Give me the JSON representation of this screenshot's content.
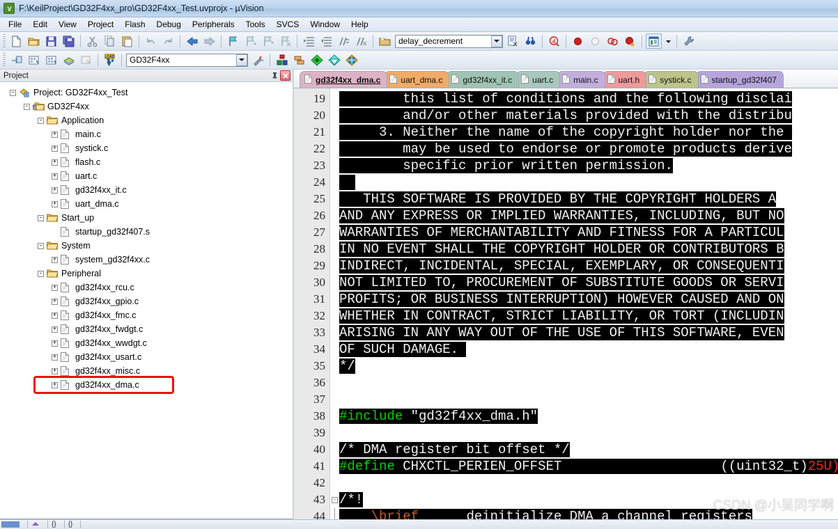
{
  "window": {
    "title": "F:\\KeilProject\\GD32F4xx_pro\\GD32F4xx_Test.uvprojx - µVision",
    "app_icon_text": "µV"
  },
  "menu": {
    "items": [
      {
        "label": "File"
      },
      {
        "label": "Edit"
      },
      {
        "label": "View"
      },
      {
        "label": "Project"
      },
      {
        "label": "Flash"
      },
      {
        "label": "Debug"
      },
      {
        "label": "Peripherals"
      },
      {
        "label": "Tools"
      },
      {
        "label": "SVCS"
      },
      {
        "label": "Window"
      },
      {
        "label": "Help"
      }
    ]
  },
  "toolbar1": {
    "buttons": [
      {
        "name": "new-file-button",
        "icon": "new-file-icon"
      },
      {
        "name": "open-file-button",
        "icon": "open-folder-icon"
      },
      {
        "name": "save-button",
        "icon": "save-disk-icon"
      },
      {
        "name": "save-all-button",
        "icon": "save-all-icon"
      },
      {
        "name": "cut-button",
        "icon": "scissors-icon"
      },
      {
        "name": "copy-button",
        "icon": "copy-icon"
      },
      {
        "name": "paste-button",
        "icon": "paste-icon"
      },
      {
        "name": "undo-button",
        "icon": "undo-arrow-icon"
      },
      {
        "name": "redo-button",
        "icon": "redo-arrow-icon"
      },
      {
        "name": "navigate-back-button",
        "icon": "arrow-left-icon"
      },
      {
        "name": "navigate-forward-button",
        "icon": "arrow-right-icon"
      },
      {
        "name": "bookmark-toggle-button",
        "icon": "bookmark-flag-icon"
      },
      {
        "name": "bookmark-prev-button",
        "icon": "bookmark-up-icon"
      },
      {
        "name": "bookmark-next-button",
        "icon": "bookmark-down-icon"
      },
      {
        "name": "bookmark-clear-button",
        "icon": "bookmark-clear-icon"
      },
      {
        "name": "indent-increase-button",
        "icon": "indent-right-icon"
      },
      {
        "name": "indent-decrease-button",
        "icon": "indent-left-icon"
      },
      {
        "name": "comment-lines-button",
        "icon": "comment-icon"
      },
      {
        "name": "uncomment-lines-button",
        "icon": "uncomment-icon"
      }
    ],
    "function_combo": {
      "name": "function-navigate-combo",
      "value": "delay_decrement"
    },
    "after_combo_buttons": [
      {
        "name": "symbol-list-button",
        "icon": "symbol-list-icon"
      },
      {
        "name": "find-in-files-button",
        "icon": "binoculars-icon"
      },
      {
        "name": "debug-start-button",
        "icon": "debug-magnify-icon"
      },
      {
        "name": "insert-breakpoint-button",
        "icon": "breakpoint-red-dot-icon"
      },
      {
        "name": "kill-breakpoint-button",
        "icon": "breakpoint-gray-dot-icon"
      },
      {
        "name": "disable-breakpoint-button",
        "icon": "breakpoint-outline-icon"
      },
      {
        "name": "kill-all-breakpoints-button",
        "icon": "breakpoint-delete-icon"
      },
      {
        "name": "window-layout-button",
        "icon": "window-panel-icon"
      },
      {
        "name": "configuration-wizard-button",
        "icon": "wrench-icon"
      }
    ]
  },
  "toolbar2": {
    "buttons": [
      {
        "name": "translate-file-button",
        "icon": "translate-icon"
      },
      {
        "name": "build-target-button",
        "icon": "build-icon"
      },
      {
        "name": "rebuild-all-button",
        "icon": "rebuild-icon"
      },
      {
        "name": "batch-build-button",
        "icon": "batch-build-icon"
      },
      {
        "name": "stop-build-button",
        "icon": "stop-build-icon"
      },
      {
        "name": "download-button",
        "icon": "load-download-icon"
      }
    ],
    "target_combo": {
      "name": "select-target-combo",
      "value": "GD32F4xx"
    },
    "after_combo_buttons": [
      {
        "name": "target-options-button",
        "icon": "magic-wand-icon"
      },
      {
        "name": "manage-project-items-button",
        "icon": "project-items-icon"
      },
      {
        "name": "multi-project-button",
        "icon": "multi-project-icon"
      },
      {
        "name": "pack-installer-button",
        "icon": "green-diamond-icon"
      },
      {
        "name": "manage-run-time-button",
        "icon": "cyan-diamond-icon"
      },
      {
        "name": "software-packs-button",
        "icon": "globe-diamond-icon"
      }
    ]
  },
  "project_panel": {
    "title": "Project",
    "pin_icon": "pin-icon",
    "close_icon": "close-icon",
    "tree": [
      {
        "label": "Project: GD32F4xx_Test",
        "depth": 0,
        "expander": "-",
        "icon": "project-icon"
      },
      {
        "label": "GD32F4xx",
        "depth": 1,
        "expander": "-",
        "icon": "target-icon"
      },
      {
        "label": "Application",
        "depth": 2,
        "expander": "-",
        "icon": "folder-icon"
      },
      {
        "label": "main.c",
        "depth": 3,
        "expander": "+",
        "icon": "file-icon"
      },
      {
        "label": "systick.c",
        "depth": 3,
        "expander": "+",
        "icon": "file-icon"
      },
      {
        "label": "flash.c",
        "depth": 3,
        "expander": "+",
        "icon": "file-icon"
      },
      {
        "label": "uart.c",
        "depth": 3,
        "expander": "+",
        "icon": "file-icon"
      },
      {
        "label": "gd32f4xx_it.c",
        "depth": 3,
        "expander": "+",
        "icon": "file-icon"
      },
      {
        "label": "uart_dma.c",
        "depth": 3,
        "expander": "+",
        "icon": "file-icon"
      },
      {
        "label": "Start_up",
        "depth": 2,
        "expander": "-",
        "icon": "folder-icon"
      },
      {
        "label": "startup_gd32f407.s",
        "depth": 3,
        "expander": "",
        "icon": "file-icon"
      },
      {
        "label": "System",
        "depth": 2,
        "expander": "-",
        "icon": "folder-icon"
      },
      {
        "label": "system_gd32f4xx.c",
        "depth": 3,
        "expander": "+",
        "icon": "file-icon"
      },
      {
        "label": "Peripheral",
        "depth": 2,
        "expander": "-",
        "icon": "folder-icon"
      },
      {
        "label": "gd32f4xx_rcu.c",
        "depth": 3,
        "expander": "+",
        "icon": "file-icon"
      },
      {
        "label": "gd32f4xx_gpio.c",
        "depth": 3,
        "expander": "+",
        "icon": "file-icon"
      },
      {
        "label": "gd32f4xx_fmc.c",
        "depth": 3,
        "expander": "+",
        "icon": "file-icon"
      },
      {
        "label": "gd32f4xx_fwdgt.c",
        "depth": 3,
        "expander": "+",
        "icon": "file-icon"
      },
      {
        "label": "gd32f4xx_wwdgt.c",
        "depth": 3,
        "expander": "+",
        "icon": "file-icon"
      },
      {
        "label": "gd32f4xx_usart.c",
        "depth": 3,
        "expander": "+",
        "icon": "file-icon"
      },
      {
        "label": "gd32f4xx_misc.c",
        "depth": 3,
        "expander": "+",
        "icon": "file-icon"
      },
      {
        "label": "gd32f4xx_dma.c",
        "depth": 3,
        "expander": "+",
        "icon": "file-icon",
        "highlighted": true
      }
    ],
    "highlight_color": "#ee1111"
  },
  "editor": {
    "tabs": [
      {
        "label": "gd32f4xx_dma.c",
        "color": "#ddb3c4",
        "active": true
      },
      {
        "label": "uart_dma.c",
        "color": "#f0ab68",
        "active": false
      },
      {
        "label": "gd32f4xx_it.c",
        "color": "#9fc4b4",
        "active": false
      },
      {
        "label": "uart.c",
        "color": "#a8c8be",
        "active": false
      },
      {
        "label": "main.c",
        "color": "#c2aedd",
        "active": false
      },
      {
        "label": "uart.h",
        "color": "#ee9a9a",
        "active": false
      },
      {
        "label": "systick.c",
        "color": "#bcc48a",
        "active": false
      },
      {
        "label": "startup_gd32f407",
        "color": "#b6a4dd",
        "active": false
      }
    ],
    "first_line": 19,
    "lines": [
      {
        "n": 19,
        "fold": "",
        "tokens": [
          {
            "t": "        this list of conditions and the following disclai",
            "c": "white"
          }
        ]
      },
      {
        "n": 20,
        "fold": "",
        "tokens": [
          {
            "t": "        and/or other materials provided with the distribu",
            "c": "white"
          }
        ]
      },
      {
        "n": 21,
        "fold": "",
        "tokens": [
          {
            "t": "     3. Neither the name of the copyright holder nor the ",
            "c": "white"
          }
        ]
      },
      {
        "n": 22,
        "fold": "",
        "tokens": [
          {
            "t": "        may be used to endorse or promote products derive",
            "c": "white"
          }
        ]
      },
      {
        "n": 23,
        "fold": "",
        "tokens": [
          {
            "t": "        specific prior written permission.",
            "c": "white"
          }
        ]
      },
      {
        "n": 24,
        "fold": "",
        "tokens": [
          {
            "t": "  ",
            "c": "white"
          }
        ]
      },
      {
        "n": 25,
        "fold": "",
        "tokens": [
          {
            "t": "   THIS SOFTWARE IS PROVIDED BY THE COPYRIGHT HOLDERS A",
            "c": "white"
          }
        ]
      },
      {
        "n": 26,
        "fold": "",
        "tokens": [
          {
            "t": "AND ANY EXPRESS OR IMPLIED WARRANTIES, INCLUDING, BUT NO",
            "c": "white"
          }
        ]
      },
      {
        "n": 27,
        "fold": "",
        "tokens": [
          {
            "t": "WARRANTIES OF MERCHANTABILITY AND FITNESS FOR A PARTICUL",
            "c": "white"
          }
        ]
      },
      {
        "n": 28,
        "fold": "",
        "tokens": [
          {
            "t": "IN NO EVENT SHALL THE COPYRIGHT HOLDER OR CONTRIBUTORS B",
            "c": "white"
          }
        ]
      },
      {
        "n": 29,
        "fold": "",
        "tokens": [
          {
            "t": "INDIRECT, INCIDENTAL, SPECIAL, EXEMPLARY, OR CONSEQUENTI",
            "c": "white"
          }
        ]
      },
      {
        "n": 30,
        "fold": "",
        "tokens": [
          {
            "t": "NOT LIMITED TO, PROCUREMENT OF SUBSTITUTE GOODS OR SERVI",
            "c": "white"
          }
        ]
      },
      {
        "n": 31,
        "fold": "",
        "tokens": [
          {
            "t": "PROFITS; OR BUSINESS INTERRUPTION) HOWEVER CAUSED AND ON",
            "c": "white"
          }
        ]
      },
      {
        "n": 32,
        "fold": "",
        "tokens": [
          {
            "t": "WHETHER IN CONTRACT, STRICT LIABILITY, OR TORT (INCLUDIN",
            "c": "white"
          }
        ]
      },
      {
        "n": 33,
        "fold": "",
        "tokens": [
          {
            "t": "ARISING IN ANY WAY OUT OF THE USE OF THIS SOFTWARE, EVEN",
            "c": "white"
          }
        ]
      },
      {
        "n": 34,
        "fold": "",
        "tokens": [
          {
            "t": "OF SUCH DAMAGE. ",
            "c": "white"
          }
        ]
      },
      {
        "n": 35,
        "fold": "",
        "tokens": [
          {
            "t": "*/",
            "c": "white"
          }
        ]
      },
      {
        "n": 36,
        "fold": "",
        "tokens": []
      },
      {
        "n": 37,
        "fold": "",
        "tokens": []
      },
      {
        "n": 38,
        "fold": "",
        "tokens": [
          {
            "t": "#include",
            "c": "green"
          },
          {
            "t": " ",
            "c": "none"
          },
          {
            "t": "\"gd32f4xx_dma.h\"",
            "c": "white"
          }
        ]
      },
      {
        "n": 39,
        "fold": "",
        "tokens": []
      },
      {
        "n": 40,
        "fold": "",
        "tokens": [
          {
            "t": "/* DMA register bit offset */",
            "c": "white"
          }
        ]
      },
      {
        "n": 41,
        "fold": "",
        "tokens": [
          {
            "t": "#define",
            "c": "green"
          },
          {
            "t": " ",
            "c": "none"
          },
          {
            "t": "CHXCTL_PERIEN_OFFSET",
            "c": "white"
          },
          {
            "t": "                    ",
            "c": "none"
          },
          {
            "t": "((uint32_t)",
            "c": "white"
          },
          {
            "t": "25U)",
            "c": "red"
          }
        ]
      },
      {
        "n": 42,
        "fold": "",
        "tokens": []
      },
      {
        "n": 43,
        "fold": "-",
        "tokens": [
          {
            "t": "/*!",
            "c": "white"
          }
        ]
      },
      {
        "n": 44,
        "fold": "|",
        "tokens": [
          {
            "t": "    ",
            "c": "none"
          },
          {
            "t": "\\brief",
            "c": "brown"
          },
          {
            "t": "      deinitialize DMA a channel registers",
            "c": "white"
          }
        ]
      }
    ],
    "watermark": "CSDN @小吴同学啊"
  },
  "colors": {
    "editor_background": "#ffffff",
    "code_text_background": "#000000",
    "code_text": "#f0f0f0",
    "keyword_green": "#00d000",
    "number_red": "#ff2020",
    "doc_tag_brown": "#c06020",
    "gutter_background": "#e9e9e9",
    "titlebar_accent": "#a9c6e3"
  }
}
